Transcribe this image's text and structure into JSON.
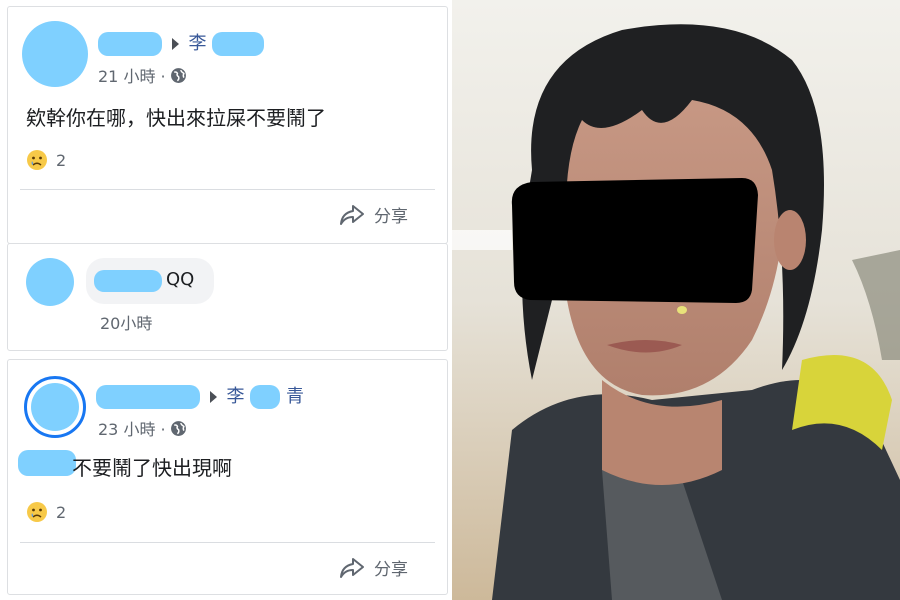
{
  "post1": {
    "name_suffix": "李",
    "time": "21 小時 ·",
    "text": "欸幹你在哪，快出來拉屎不要鬧了",
    "reaction_count": "2",
    "share_label": "分享"
  },
  "comment": {
    "text": "QQ",
    "time": "20小時"
  },
  "post2": {
    "name_suffix": "李",
    "name_tail": "青",
    "time": "23 小時 ·",
    "text": "不要鬧了快出現啊",
    "reaction_count": "2",
    "share_label": "分享"
  },
  "icons": {
    "globe": "globe-icon",
    "reaction": "sad-reaction-icon",
    "share": "share-icon"
  },
  "colors": {
    "censor_blue": "#7fd0ff",
    "link_blue": "#385898",
    "meta_gray": "#606770",
    "jacket_yellow": "#d8d43a"
  }
}
